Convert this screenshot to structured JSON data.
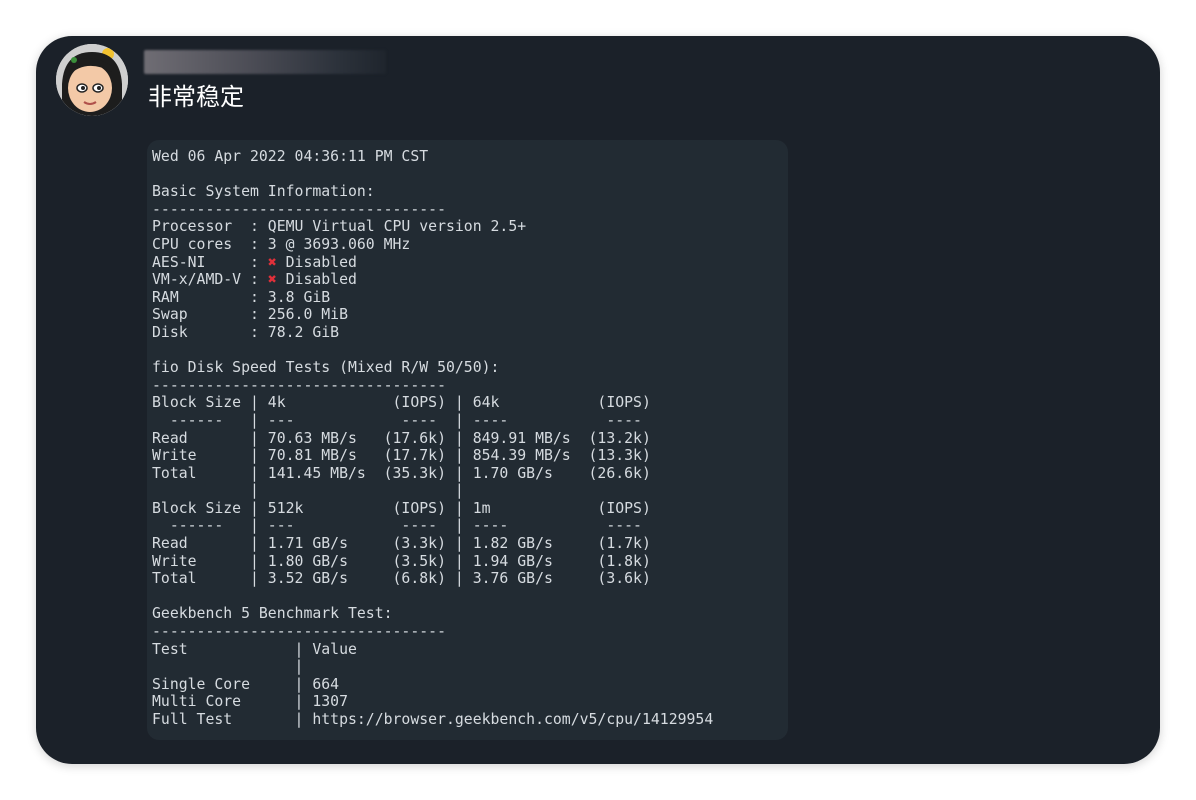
{
  "message": {
    "text": "非常稳定"
  },
  "terminal": {
    "lines": [
      "Wed 06 Apr 2022 04:36:11 PM CST",
      "",
      "Basic System Information:",
      "---------------------------------",
      "Processor  : QEMU Virtual CPU version 2.5+",
      "CPU cores  : 3 @ 3693.060 MHz",
      "AES-NI     : ❌ Disabled",
      "VM-x/AMD-V : ❌ Disabled",
      "RAM        : 3.8 GiB",
      "Swap       : 256.0 MiB",
      "Disk       : 78.2 GiB",
      "",
      "fio Disk Speed Tests (Mixed R/W 50/50):",
      "---------------------------------",
      "Block Size | 4k            (IOPS) | 64k           (IOPS)",
      "  ------   | ---            ----  | ----           ----",
      "Read       | 70.63 MB/s   (17.6k) | 849.91 MB/s  (13.2k)",
      "Write      | 70.81 MB/s   (17.7k) | 854.39 MB/s  (13.3k)",
      "Total      | 141.45 MB/s  (35.3k) | 1.70 GB/s    (26.6k)",
      "           |                      |",
      "Block Size | 512k          (IOPS) | 1m            (IOPS)",
      "  ------   | ---            ----  | ----           ----",
      "Read       | 1.71 GB/s     (3.3k) | 1.82 GB/s     (1.7k)",
      "Write      | 1.80 GB/s     (3.5k) | 1.94 GB/s     (1.8k)",
      "Total      | 3.52 GB/s     (6.8k) | 3.76 GB/s     (3.6k)",
      "",
      "Geekbench 5 Benchmark Test:",
      "---------------------------------",
      "Test            | Value",
      "                |",
      "Single Core     | 664",
      "Multi Core      | 1307",
      "Full Test       | https://browser.geekbench.com/v5/cpu/14129954"
    ]
  },
  "colors": {
    "background": "#1b2129",
    "terminal_bg": "#222b33",
    "text": "#d6dbe0",
    "x_mark": "#e0303a"
  }
}
